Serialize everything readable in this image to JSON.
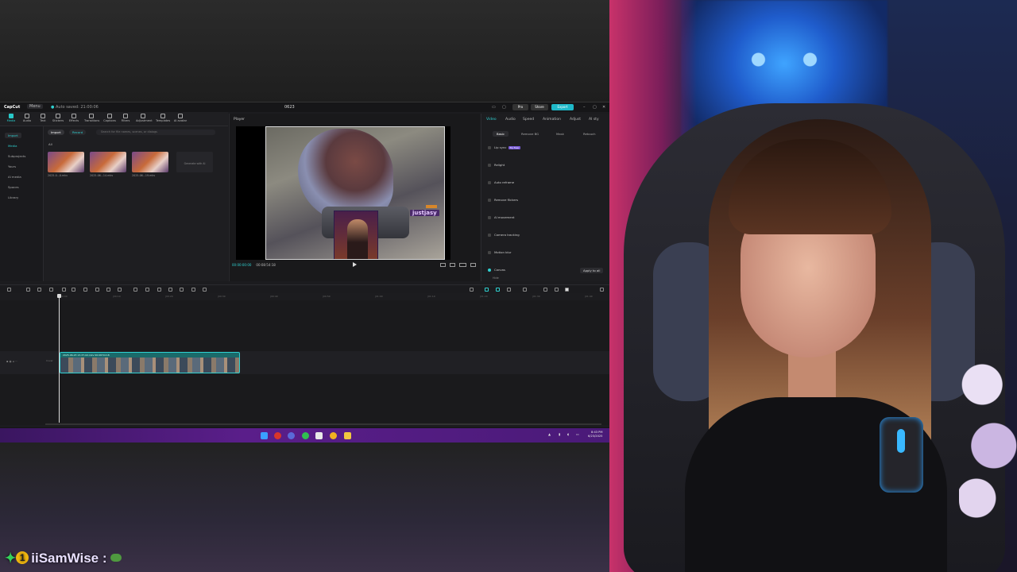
{
  "app": {
    "name": "CapCut",
    "menu_label": "Menu",
    "autosave_text": "Auto saved: 21:00:06",
    "project_title": "0623",
    "header_buttons": {
      "pro": "Pro",
      "share": "Share",
      "export": "Export"
    }
  },
  "toolbar": {
    "items": [
      {
        "label": "Media",
        "icon": "media-icon"
      },
      {
        "label": "Audio",
        "icon": "audio-icon"
      },
      {
        "label": "Text",
        "icon": "text-icon"
      },
      {
        "label": "Stickers",
        "icon": "sticker-icon"
      },
      {
        "label": "Effects",
        "icon": "effects-icon"
      },
      {
        "label": "Transitions",
        "icon": "transition-icon"
      },
      {
        "label": "Captions",
        "icon": "caption-icon"
      },
      {
        "label": "Filters",
        "icon": "filter-icon"
      },
      {
        "label": "Adjustment",
        "icon": "adjustment-icon"
      },
      {
        "label": "Templates",
        "icon": "template-icon"
      },
      {
        "label": "AI avatar",
        "icon": "avatar-icon"
      }
    ]
  },
  "left_nav": {
    "items": [
      "Import",
      "Media",
      "Subprojects",
      "Yours",
      "AI media",
      "Spaces",
      "Library"
    ],
    "selected_index": 1
  },
  "media_panel": {
    "import_label": "Import",
    "record_label": "Record",
    "search_placeholder": "Search for file names, scenes, or dialogs",
    "all_label": "All",
    "files": [
      {
        "name": "2025-0...0.mkv"
      },
      {
        "name": "2025-06...14.mkv"
      },
      {
        "name": "2025-06...19.mkv"
      }
    ],
    "generate_label": "Generate with AI"
  },
  "player": {
    "label": "Player",
    "current_time": "00:00:00:00",
    "duration": "00:08:54:18",
    "overlay_name": "justjasy"
  },
  "inspector": {
    "tabs": [
      "Video",
      "Audio",
      "Speed",
      "Animation",
      "Adjust",
      "AI sty"
    ],
    "selected_tab": 0,
    "subtabs": [
      "Basic",
      "Remove BG",
      "Mask",
      "Retouch"
    ],
    "selected_subtab": 0,
    "rows": [
      {
        "label": "Lip sync",
        "badge": "Try free"
      },
      {
        "label": "Relight",
        "badge": ""
      },
      {
        "label": "Auto reframe",
        "badge": ""
      },
      {
        "label": "Remove flickers",
        "badge": ""
      },
      {
        "label": "AI movement",
        "badge": ""
      },
      {
        "label": "Camera tracking",
        "badge": ""
      },
      {
        "label": "Motion blur",
        "badge": ""
      },
      {
        "label": "Canvas",
        "badge": ""
      }
    ],
    "apply_all_label": "Apply to all",
    "cut_row": "Hide"
  },
  "timeline": {
    "ruler_ticks": [
      "00:00",
      "|00:10",
      "|00:20",
      "|00:30",
      "|00:40",
      "|00:50",
      "|01:00",
      "|01:10",
      "|01:20",
      "|01:30",
      "|01:40"
    ],
    "clip_title": "2025-06-23 13-37-02.mkv  00:08:54:18",
    "track_label": "Cover"
  },
  "taskbar": {
    "clock_time": "8:43 PM",
    "clock_date": "6/23/2025"
  },
  "chat": {
    "badge_count": "1",
    "username": "iiSamWise",
    "separator": " :"
  },
  "colors": {
    "accent": "#2fd0d0",
    "taskbar": "#5a1e8a",
    "chat_name": "#e9e0ff"
  }
}
